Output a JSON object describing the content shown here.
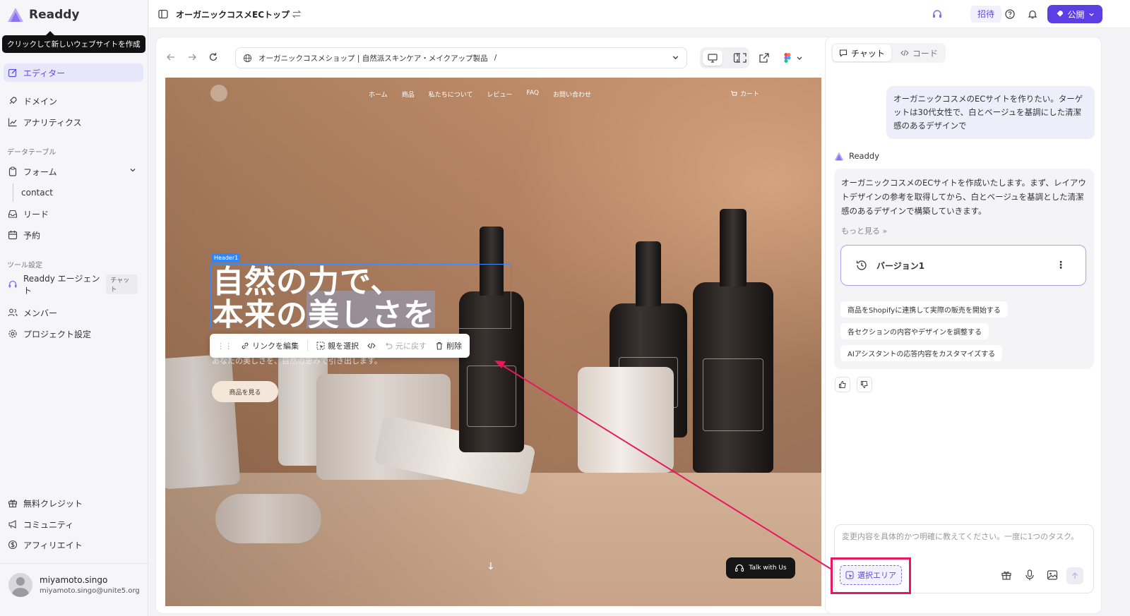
{
  "app": {
    "name": "Readdy"
  },
  "tooltip": "クリックして新しいウェブサイトを作成",
  "sidebar": {
    "editor": "エディター",
    "domain": "ドメイン",
    "analytics": "アナリティクス",
    "section_data": "データテーブル",
    "form": "フォーム",
    "form_sub": "contact",
    "lead": "リード",
    "booking": "予約",
    "section_tools": "ツール設定",
    "agent": "Readdy エージェント",
    "agent_badge": "チャット",
    "members": "メンバー",
    "project_settings": "プロジェクト設定",
    "credits": "無料クレジット",
    "community": "コミュニティ",
    "affiliate": "アフィリエイト"
  },
  "user": {
    "name": "miyamoto.singo",
    "email": "miyamoto.singo@unite5.org"
  },
  "topbar": {
    "project_title": "オーガニックコスメECトップ",
    "invite": "招待",
    "publish": "公開"
  },
  "browser": {
    "url_title": "オーガニックコスメショップ | 自然派スキンケア・メイクアップ製品",
    "path": "/"
  },
  "site": {
    "nav": [
      "ホーム",
      "商品",
      "私たちについて",
      "レビュー",
      "FAQ",
      "お問い合わせ"
    ],
    "cart": "カート",
    "header_tag": "Header1",
    "hero_line1": "自然の力で、",
    "hero_line2": "本来の美しさを",
    "hero_sub": "あなたの美しさを、自然の恵みで引き出します。",
    "hero_button": "商品を見る",
    "talk": "Talk with Us"
  },
  "edit_toolbar": {
    "edit_link": "リンクを編集",
    "select_parent": "親を選択",
    "undo": "元に戻す",
    "delete": "削除"
  },
  "chat": {
    "tab_chat": "チャット",
    "tab_code": "コード",
    "user_message": "オーガニックコスメのECサイトを作りたい。ターゲットは30代女性で、白とベージュを基調にした清潔感のあるデザインで",
    "bot_name": "Readdy",
    "bot_message": "オーガニックコスメのECサイトを作成いたします。まず、レイアウトデザインの参考を取得してから、白とベージュを基調とした清潔感のあるデザインで構築していきます。",
    "more": "もっと見る",
    "version": "バージョン1",
    "suggestions": [
      "商品をShopifyに連携して実際の販売を開始する",
      "各セクションの内容やデザインを調整する",
      "AIアシスタントの応答内容をカスタマイズする"
    ],
    "input_placeholder": "変更内容を具体的かつ明確に教えてください。一度に1つのタスク。",
    "select_area": "選択エリア"
  },
  "colors": {
    "accent": "#5b3fe4",
    "highlight": "#e8185f",
    "selection": "#3a8cff"
  },
  "icons": [
    "layout-icon",
    "swap-icon",
    "headset-icon",
    "help-icon",
    "bell-icon",
    "rocket-icon",
    "globe-icon",
    "desktop-icon",
    "mobile-icon",
    "fullscreen-icon",
    "external-link-icon",
    "figma-icon"
  ]
}
